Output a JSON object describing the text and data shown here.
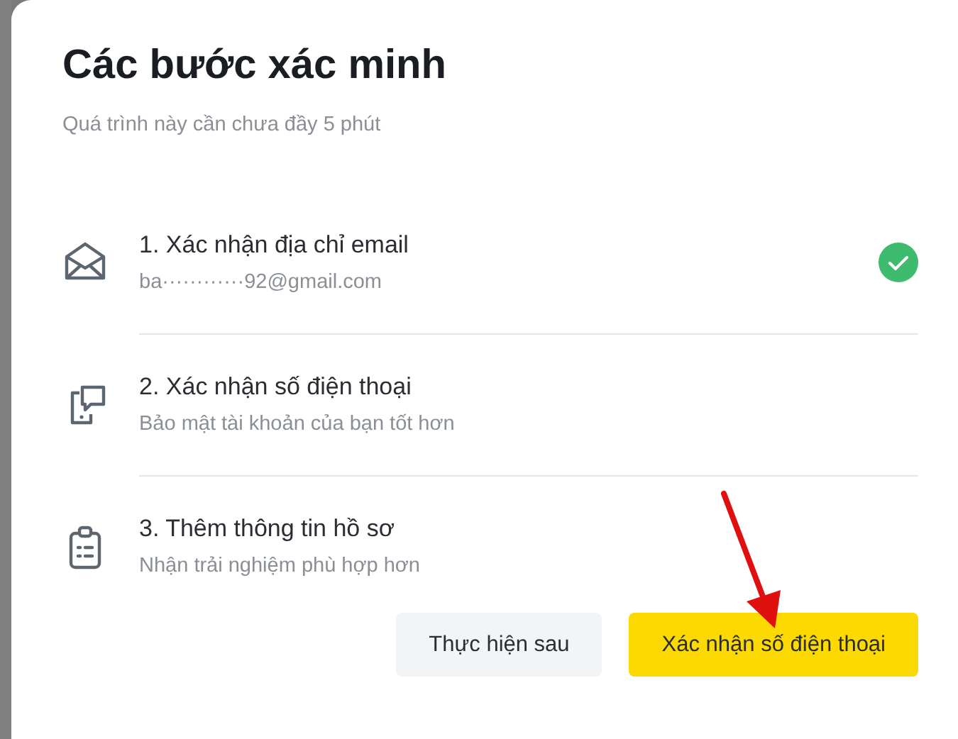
{
  "dialog": {
    "title": "Các bước xác minh",
    "subtitle": "Quá trình này cần chưa đầy 5 phút"
  },
  "steps": [
    {
      "kind": "email",
      "title": "1. Xác nhận địa chỉ email",
      "detail": "ba············92@gmail.com",
      "completed": true
    },
    {
      "kind": "phone",
      "title": "2. Xác nhận số điện thoại",
      "detail": "Bảo mật tài khoản của bạn tốt hơn",
      "completed": false
    },
    {
      "kind": "profile",
      "title": "3. Thêm thông tin hồ sơ",
      "detail": "Nhận trải nghiệm phù hợp hơn",
      "completed": false
    }
  ],
  "buttons": [
    {
      "kind": "secondary",
      "label": "Thực hiện sau"
    },
    {
      "kind": "primary",
      "label": "Xác nhận số điện thoại"
    }
  ]
}
